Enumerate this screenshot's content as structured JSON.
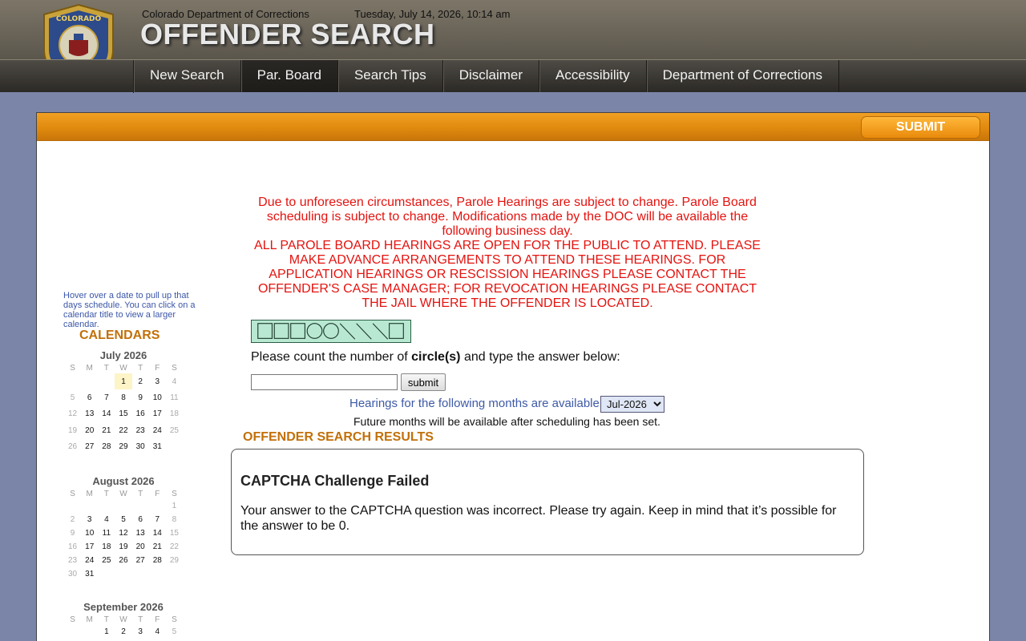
{
  "header": {
    "department": "Colorado Department of Corrections",
    "datetime": "Tuesday, July 14, 2026, 10:14 am",
    "title": "OFFENDER SEARCH",
    "logo_text": "COLORADO DEPARTMENT OF CORRECTIONS"
  },
  "nav": {
    "items": [
      {
        "label": "New Search"
      },
      {
        "label": "Par. Board"
      },
      {
        "label": "Search Tips"
      },
      {
        "label": "Disclaimer"
      },
      {
        "label": "Accessibility"
      },
      {
        "label": "Department of Corrections"
      }
    ],
    "active_index": 1
  },
  "toolbar": {
    "submit_label": "SUBMIT"
  },
  "sidebar": {
    "hint": "Hover over a date to pull up that days schedule. You can click on a calendar title to view a larger calendar.",
    "heading": "CALENDARS",
    "calendars": [
      {
        "title": "July 2026",
        "dow": [
          "S",
          "M",
          "T",
          "W",
          "T",
          "F",
          "S"
        ],
        "weeks": [
          [
            "",
            "",
            "",
            "1",
            "2",
            "3",
            "4"
          ],
          [
            "5",
            "6",
            "7",
            "8",
            "9",
            "10",
            "11"
          ],
          [
            "12",
            "13",
            "14",
            "15",
            "16",
            "17",
            "18"
          ],
          [
            "19",
            "20",
            "21",
            "22",
            "23",
            "24",
            "25"
          ],
          [
            "26",
            "27",
            "28",
            "29",
            "30",
            "31",
            ""
          ]
        ]
      },
      {
        "title": "August 2026",
        "dow": [
          "S",
          "M",
          "T",
          "W",
          "T",
          "F",
          "S"
        ],
        "weeks": [
          [
            "",
            "",
            "",
            "",
            "",
            "",
            "1"
          ],
          [
            "2",
            "3",
            "4",
            "5",
            "6",
            "7",
            "8"
          ],
          [
            "9",
            "10",
            "11",
            "12",
            "13",
            "14",
            "15"
          ],
          [
            "16",
            "17",
            "18",
            "19",
            "20",
            "21",
            "22"
          ],
          [
            "23",
            "24",
            "25",
            "26",
            "27",
            "28",
            "29"
          ],
          [
            "30",
            "31",
            "",
            "",
            "",
            "",
            ""
          ]
        ]
      },
      {
        "title": "September 2026",
        "dow": [
          "S",
          "M",
          "T",
          "W",
          "T",
          "F",
          "S"
        ],
        "weeks": [
          [
            "",
            "",
            "1",
            "2",
            "3",
            "4",
            "5"
          ]
        ]
      }
    ]
  },
  "notice": {
    "line1": "Due to unforeseen circumstances, Parole Hearings are subject to change. Parole Board scheduling is subject to change. Modifications made by the DOC will be available the following business day.",
    "line2": "ALL PAROLE BOARD HEARINGS ARE OPEN FOR THE PUBLIC TO ATTEND. PLEASE MAKE ADVANCE ARRANGEMENTS TO ATTEND THESE HEARINGS. FOR APPLICATION HEARINGS OR RESCISSION HEARINGS PLEASE CONTACT THE OFFENDER'S CASE MANAGER; FOR REVOCATION HEARINGS PLEASE CONTACT THE JAIL WHERE THE OFFENDER IS LOCATED."
  },
  "captcha": {
    "question_pre": "Please count the number of ",
    "question_bold": "circle(s)",
    "question_post": " and type the answer below:",
    "input_value": "",
    "submit_label": "submit",
    "shapes": [
      "square",
      "square",
      "square",
      "circle",
      "circle",
      "slash",
      "slash",
      "slash",
      "square"
    ]
  },
  "months": {
    "label": "Hearings for the following months are available:",
    "selected": "Jul-2026",
    "note": "Future months will be available after scheduling has been set."
  },
  "results": {
    "heading": "OFFENDER SEARCH RESULTS",
    "title": "CAPTCHA Challenge Failed",
    "message": "Your answer to the CAPTCHA question was incorrect. Please try again. Keep in mind that it’s possible for the answer to be 0."
  },
  "colors": {
    "notice_red": "#e4130f",
    "accent_orange": "#c27009",
    "link_blue": "#3e5aa6",
    "page_bg": "#7b85a8"
  }
}
